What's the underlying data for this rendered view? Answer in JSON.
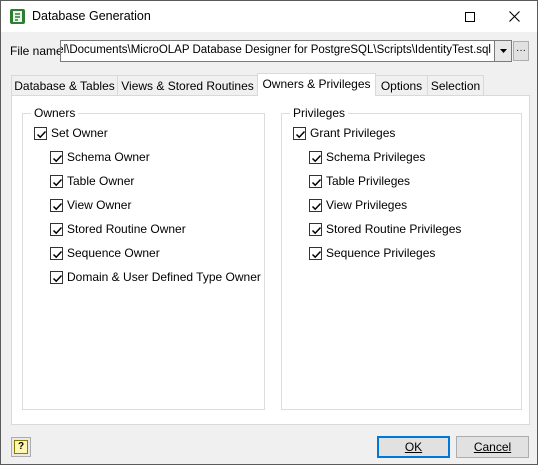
{
  "window": {
    "title": "Database Generation"
  },
  "file": {
    "label": "File name",
    "value": "el\\Documents\\MicroOLAP Database Designer for PostgreSQL\\Scripts\\IdentityTest.sql",
    "browse_label": "···"
  },
  "tabs": [
    {
      "label": "Database & Tables",
      "active": false
    },
    {
      "label": "Views & Stored Routines",
      "active": false
    },
    {
      "label": "Owners & Privileges",
      "active": true
    },
    {
      "label": "Options",
      "active": false
    },
    {
      "label": "Selection",
      "active": false
    }
  ],
  "owners": {
    "title": "Owners",
    "set_owner": {
      "label": "Set Owner",
      "checked": true
    },
    "items": [
      {
        "label": "Schema Owner",
        "checked": true
      },
      {
        "label": "Table Owner",
        "checked": true
      },
      {
        "label": "View Owner",
        "checked": true
      },
      {
        "label": "Stored Routine Owner",
        "checked": true
      },
      {
        "label": "Sequence Owner",
        "checked": true
      },
      {
        "label": "Domain & User Defined Type Owner",
        "checked": true
      }
    ]
  },
  "privileges": {
    "title": "Privileges",
    "grant": {
      "label": "Grant Privileges",
      "checked": true
    },
    "items": [
      {
        "label": "Schema Privileges",
        "checked": true
      },
      {
        "label": "Table Privileges",
        "checked": true
      },
      {
        "label": "View Privileges",
        "checked": true
      },
      {
        "label": "Stored Routine Privileges",
        "checked": true
      },
      {
        "label": "Sequence Privileges",
        "checked": true
      }
    ]
  },
  "buttons": {
    "ok_label": "OK",
    "cancel_label": "Cancel",
    "help_label": "?"
  },
  "colors": {
    "accent": "#0078d7",
    "window_bg": "#f0f0f0"
  }
}
